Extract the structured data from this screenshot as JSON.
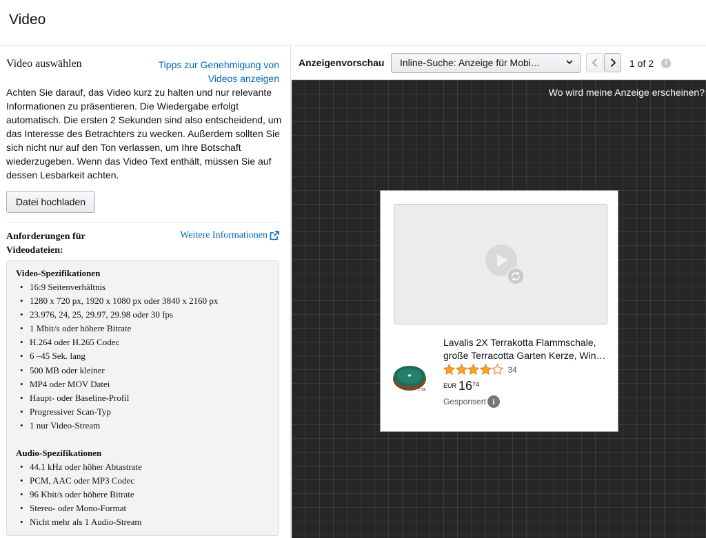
{
  "header": {
    "title": "Video"
  },
  "left": {
    "section_title": "Video auswählen",
    "tips_link": "Tipps zur Genehmigung von Videos anzeigen",
    "description": "Achten Sie darauf, das Video kurz zu halten und nur relevante Informationen zu präsentieren. Die Wiedergabe erfolgt automatisch. Die ersten 2 Sekunden sind also entscheidend, um das Interesse des Betrachters zu wecken. Außerdem sollten Sie sich nicht nur auf den Ton verlassen, um Ihre Botschaft wiederzugeben. Wenn das Video Text enthält, müssen Sie auf dessen Lesbarkeit achten.",
    "upload_button": "Datei hochladen",
    "requirements_title": "Anforderungen für Videodateien:",
    "more_info_link": "Weitere Informationen",
    "video_specs_title": "Video-Spezifikationen",
    "video_specs": [
      "16:9 Seitenverhältnis",
      "1280 x 720 px, 1920 x 1080 px oder 3840 x 2160 px",
      "23.976, 24, 25, 29.97, 29.98 oder 30 fps",
      "1 Mbit/s oder höhere Bitrate",
      "H.264 oder H.265 Codec",
      "6 –45 Sek. lang",
      "500 MB oder kleiner",
      "MP4 oder MOV Datei",
      "Haupt- oder Baseline-Profil",
      "Progressiver Scan-Typ",
      "1 nur Video-Stream"
    ],
    "audio_specs_title": "Audio-Spezifikationen",
    "audio_specs": [
      "44.1 kHz oder höher Abtastrate",
      "PCM, AAC oder MP3 Codec",
      "96 Kbit/s oder höhere Bitrate",
      "Stereo- oder Mono-Format",
      "Nicht mehr als 1 Audio-Stream"
    ]
  },
  "preview": {
    "label": "Anzeigenvorschau",
    "select_value": "Inline-Suche: Anzeige für Mobi…",
    "pager": "1 of 2",
    "where_link": "Wo wird meine Anzeige erscheinen?",
    "ad": {
      "product_title": "Lavalis 2X Terrakotta Flammschale, große Terracotta Garten Kerze, Win…",
      "rating": 4,
      "rating_max": 5,
      "review_count": "34",
      "currency": "EUR",
      "price_whole": "16",
      "price_fraction": "74",
      "sponsored_label": "Gesponsert",
      "image_badge": "2 Stk."
    }
  },
  "colors": {
    "link": "#0066c0",
    "star": "#ffa41c",
    "stage_bg": "#262626"
  },
  "icons": [
    "external-link-icon",
    "chevron-down-icon",
    "chevron-left-icon",
    "chevron-right-icon",
    "info-icon",
    "play-icon",
    "replay-icon",
    "star-icon"
  ]
}
